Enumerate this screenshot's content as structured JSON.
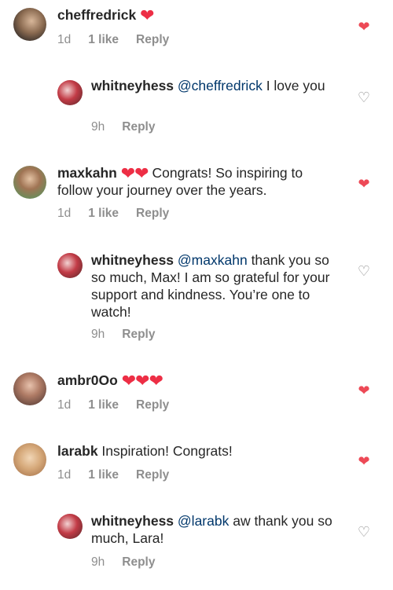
{
  "colors": {
    "liked_heart": "#ed4956",
    "mention": "#00376b",
    "meta": "#8e8e8e"
  },
  "heart_emoji": "❤",
  "icons": {
    "liked": "heart-filled-icon",
    "unliked": "heart-outline-icon"
  },
  "comments": [
    {
      "username": "cheffredrick",
      "text": "",
      "emoji": "❤",
      "time": "1d",
      "likes": "1 like",
      "reply": "Reply",
      "liked": true,
      "replies": [
        {
          "username": "whitneyhess",
          "mention": "@cheffredrick",
          "text": " I love you",
          "time": "9h",
          "reply": "Reply",
          "liked": false
        }
      ]
    },
    {
      "username": "maxkahn",
      "emoji": "❤❤",
      "text": " Congrats! So inspiring to follow your journey over the years.",
      "time": "1d",
      "likes": "1 like",
      "reply": "Reply",
      "liked": true,
      "replies": [
        {
          "username": "whitneyhess",
          "mention": "@maxkahn",
          "text": " thank you so so much, Max! I am so grateful for your support and kindness. You’re one to watch!",
          "time": "9h",
          "reply": "Reply",
          "liked": false
        }
      ]
    },
    {
      "username": "ambr0Oo",
      "emoji": "❤❤❤",
      "text": "",
      "time": "1d",
      "likes": "1 like",
      "reply": "Reply",
      "liked": true
    },
    {
      "username": "larabk",
      "text": " Inspiration! Congrats!",
      "time": "1d",
      "likes": "1 like",
      "reply": "Reply",
      "liked": true,
      "replies": [
        {
          "username": "whitneyhess",
          "mention": "@larabk",
          "text": " aw thank you so much, Lara!",
          "time": "9h",
          "reply": "Reply",
          "liked": false
        }
      ]
    }
  ]
}
